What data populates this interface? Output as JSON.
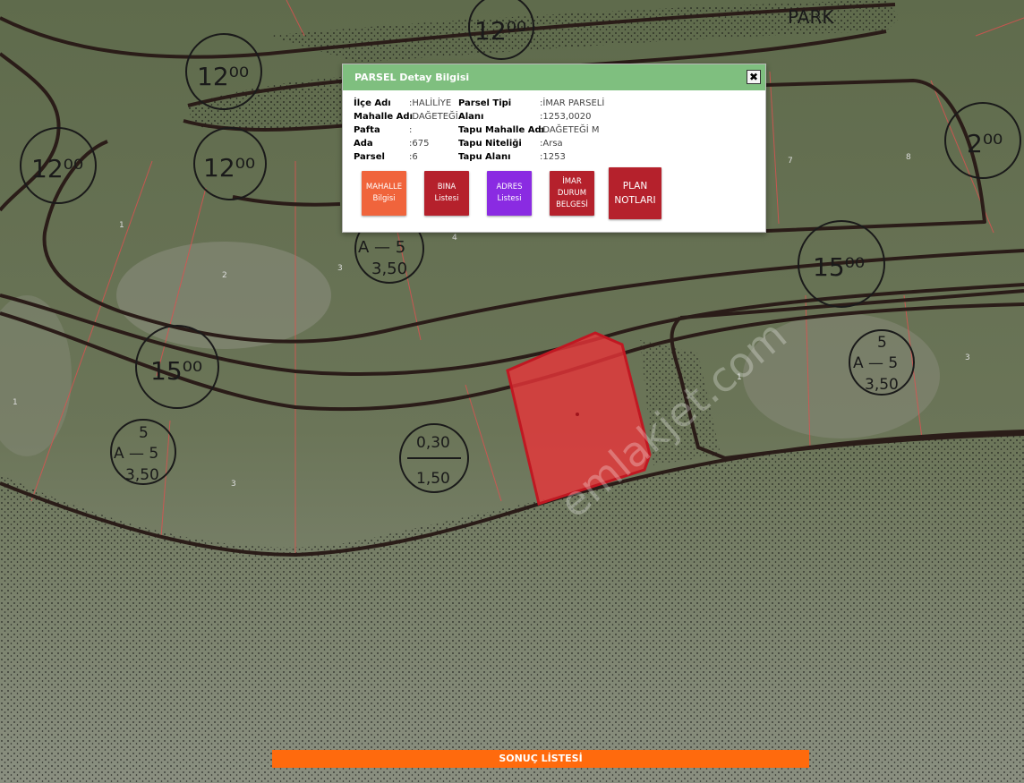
{
  "map": {
    "labels": {
      "park": "PARK",
      "z1": "12⁰⁰",
      "z2": "12⁰⁰",
      "z3": "12⁰⁰",
      "z4": "12⁰⁰",
      "z5": "2⁰⁰",
      "z6": "15⁰⁰",
      "z7": "15⁰⁰",
      "a_top_left": "A — 5",
      "a_top_left_sub": "3,50",
      "a_right": "5",
      "a_right_mid": "A — 5",
      "a_right_sub": "3,50",
      "a_bottom_top": "5",
      "a_bottom_mid": "A — 5",
      "a_bottom_sub": "3,50",
      "ratio_top": "0,30",
      "ratio_bottom": "1,50"
    },
    "parcel_numbers": [
      "1",
      "2",
      "3",
      "4",
      "7",
      "8",
      "1",
      "3",
      "1",
      "3"
    ],
    "watermark": "emlakjet.com",
    "selected_parcel_color": "#e8343a"
  },
  "panel": {
    "title": "PARSEL Detay Bilgisi",
    "close": "✖",
    "left": [
      {
        "label": "İlçe Adı",
        "value": ":HALİLİYE"
      },
      {
        "label": "Mahalle Adı",
        "value": ":DAĞETEĞİ"
      },
      {
        "label": "Pafta",
        "value": ":"
      },
      {
        "label": "Ada",
        "value": ":675"
      },
      {
        "label": "Parsel",
        "value": ":6"
      }
    ],
    "right": [
      {
        "label": "Parsel Tipi",
        "value": ":İMAR PARSELİ"
      },
      {
        "label": "Alanı",
        "value": ":1253,0020"
      },
      {
        "label": "Tapu Mahalle Adı",
        "value": ":DAĞETEĞİ M"
      },
      {
        "label": "Tapu Niteliği",
        "value": ":Arsa"
      },
      {
        "label": "Tapu Alanı",
        "value": ":1253"
      }
    ],
    "buttons": {
      "mahalle": {
        "line1": "MAHALLE",
        "line2": "Bilgisi",
        "color": "#f0643c"
      },
      "bina": {
        "line1": "BINA",
        "line2": "Listesi",
        "color": "#b5212c"
      },
      "adres": {
        "line1": "ADRES",
        "line2": "Listesi",
        "color": "#8a2be2"
      },
      "imar": {
        "line1": "İMAR",
        "line2": "DURUM",
        "line3": "BELGESİ",
        "color": "#b5212c"
      },
      "plan": {
        "line1": "PLAN",
        "line2": "NOTLARI",
        "color": "#b5212c"
      }
    }
  },
  "bottom_bar": {
    "label": "SONUÇ LİSTESİ",
    "color": "#ff6a0d"
  }
}
